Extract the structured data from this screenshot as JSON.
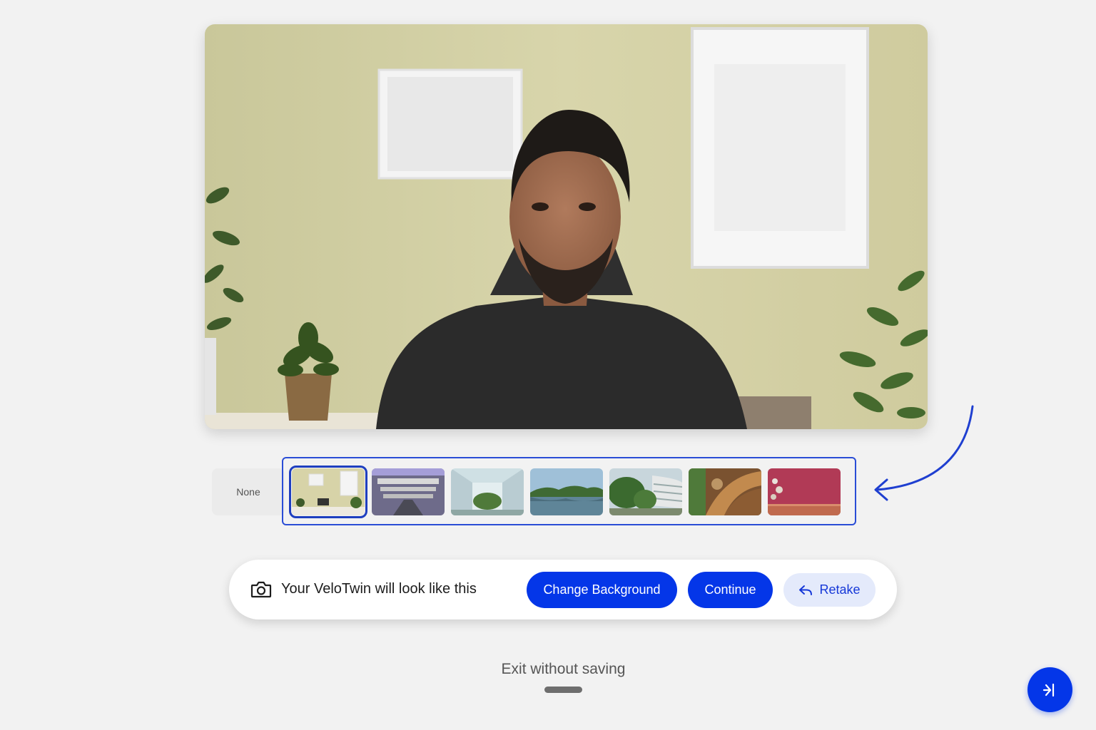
{
  "preview": {
    "subject": "webcam preview with virtual background"
  },
  "backgrounds": {
    "none_label": "None",
    "selected_index": 0,
    "items": [
      {
        "name": "home-office"
      },
      {
        "name": "modern-atrium"
      },
      {
        "name": "glass-atrium-garden"
      },
      {
        "name": "lake-forest"
      },
      {
        "name": "tropical-campus"
      },
      {
        "name": "wooden-spiral-interior"
      },
      {
        "name": "pink-wall-studio"
      }
    ]
  },
  "action_bar": {
    "camera_icon": "camera-icon",
    "label": "Your VeloTwin will look like this",
    "change_background_label": "Change Background",
    "continue_label": "Continue",
    "retake_label": "Retake"
  },
  "exit": {
    "label": "Exit without saving"
  },
  "fab": {
    "icon": "collapse-right-icon"
  },
  "colors": {
    "primary": "#0436e8",
    "secondary_bg": "#e4eafb",
    "secondary_text": "#1638d8",
    "strip_border": "#2a4dd6",
    "page_bg": "#f2f2f2"
  }
}
